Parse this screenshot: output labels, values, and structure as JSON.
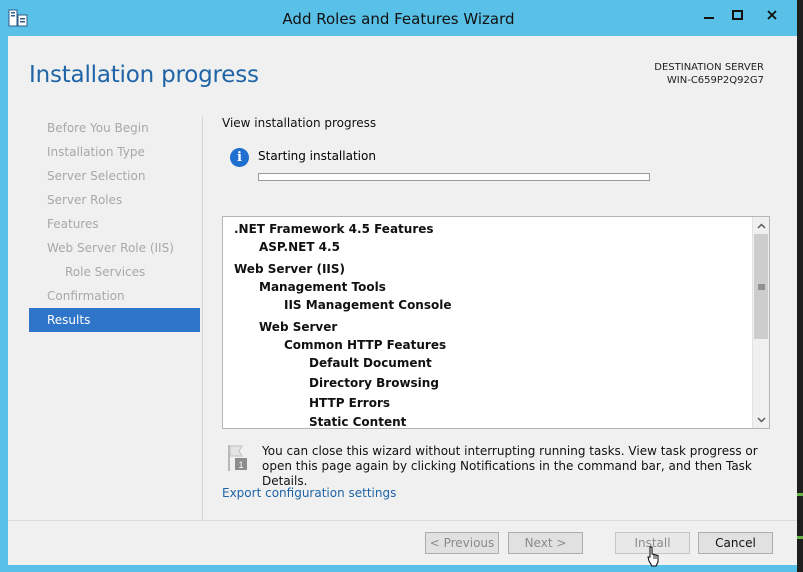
{
  "window": {
    "title": "Add Roles and Features Wizard",
    "controls": {
      "minimize": "minimize",
      "maximize": "maximize",
      "close": "close"
    }
  },
  "header": {
    "page_title": "Installation progress",
    "destination_label": "DESTINATION SERVER",
    "destination_server": "WIN-C659P2Q92G7"
  },
  "nav": {
    "items": [
      {
        "label": "Before You Begin"
      },
      {
        "label": "Installation Type"
      },
      {
        "label": "Server Selection"
      },
      {
        "label": "Server Roles"
      },
      {
        "label": "Features"
      },
      {
        "label": "Web Server Role (IIS)"
      },
      {
        "label": "Role Services"
      },
      {
        "label": "Confirmation"
      },
      {
        "label": "Results"
      }
    ],
    "active": "Results"
  },
  "main": {
    "section_label": "View installation progress",
    "status": "Starting installation",
    "progress_percent": 0,
    "features": [
      {
        "label": ".NET Framework 4.5 Features",
        "level": 0
      },
      {
        "label": "ASP.NET 4.5",
        "level": 1
      },
      {
        "label": "Web Server (IIS)",
        "level": 0
      },
      {
        "label": "Management Tools",
        "level": 1
      },
      {
        "label": "IIS Management Console",
        "level": 2
      },
      {
        "label": "Web Server",
        "level": 1
      },
      {
        "label": "Common HTTP Features",
        "level": 2
      },
      {
        "label": "Default Document",
        "level": 3
      },
      {
        "label": "Directory Browsing",
        "level": 3
      },
      {
        "label": "HTTP Errors",
        "level": 3
      },
      {
        "label": "Static Content",
        "level": 3
      }
    ],
    "notice": "You can close this wizard without interrupting running tasks. View task progress or open this page again by clicking Notifications in the command bar, and then Task Details.",
    "notice_badge": "1",
    "export_link": "Export configuration settings"
  },
  "footer": {
    "previous": "< Previous",
    "next": "Next >",
    "install": "Install",
    "cancel": "Cancel"
  },
  "colors": {
    "titlebar": "#59c1e8",
    "accent": "#1e64a6",
    "nav_active": "#2e74c8"
  }
}
